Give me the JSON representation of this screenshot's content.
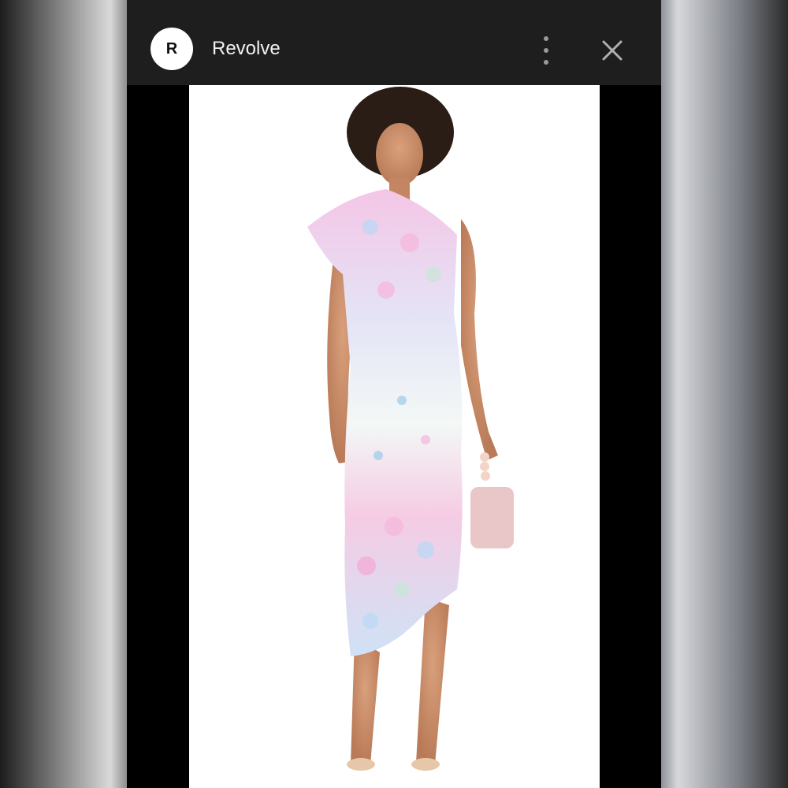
{
  "header": {
    "logo_letter": "R",
    "site_name": "Revolve",
    "more_icon": "more-vertical-icon",
    "close_icon": "close-icon"
  },
  "product_image": {
    "background": "#ffffff",
    "dress_colors": [
      "#f7c6e3",
      "#b9d9f5",
      "#f2f6f4"
    ],
    "bag_color": "#e9c6c8"
  }
}
